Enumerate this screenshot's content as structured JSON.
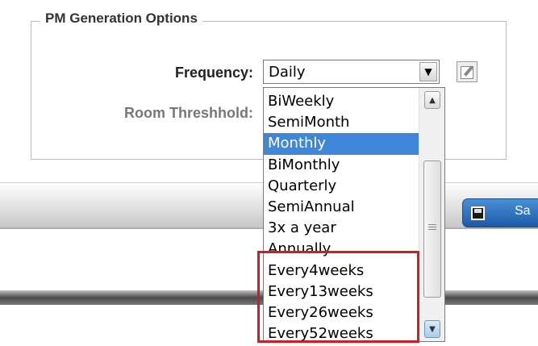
{
  "group": {
    "legend": "PM Generation Options"
  },
  "form": {
    "frequency_label": "Frequency:",
    "threshold_label": "Room Threshhold:",
    "frequency_value": "Daily"
  },
  "dropdown": {
    "options": [
      "BiWeekly",
      "SemiMonth",
      "Monthly",
      "BiMonthly",
      "Quarterly",
      "SemiAnnual",
      "3x a year",
      "Annually",
      "Every4weeks",
      "Every13weeks",
      "Every26weeks",
      "Every52weeks"
    ],
    "highlighted": "Monthly"
  },
  "toolbar": {
    "save_label": "Sa"
  },
  "icons": {
    "select_arrow": "chevron-down-icon",
    "edit": "edit-icon",
    "save": "floppy-disk-icon",
    "scroll_up": "arrow-up-icon",
    "scroll_down": "arrow-down-icon"
  },
  "colors": {
    "selection": "#3f86d8",
    "annotation": "#d51a22",
    "button": "#2a6cc0"
  }
}
